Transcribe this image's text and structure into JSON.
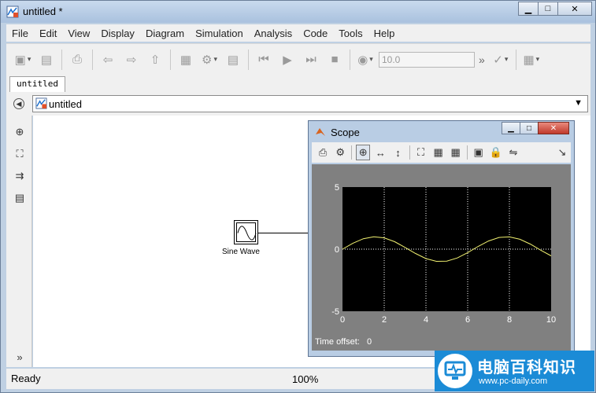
{
  "window": {
    "title": "untitled *"
  },
  "menu": [
    "File",
    "Edit",
    "View",
    "Display",
    "Diagram",
    "Simulation",
    "Analysis",
    "Code",
    "Tools",
    "Help"
  ],
  "toolbar": {
    "stop_time": "10.0"
  },
  "tab": {
    "label": "untitled"
  },
  "explorer": {
    "path": "untitled"
  },
  "canvas": {
    "block_label": "Sine Wave"
  },
  "status": {
    "left": "Ready",
    "zoom": "100%"
  },
  "scope": {
    "title": "Scope",
    "time_offset_label": "Time offset:",
    "time_offset_value": "0"
  },
  "chart_data": {
    "type": "line",
    "title": "",
    "xlabel": "",
    "ylabel": "",
    "xlim": [
      0,
      10
    ],
    "ylim": [
      -5,
      5
    ],
    "xticks": [
      "0",
      "2",
      "4",
      "6",
      "8",
      "10"
    ],
    "yticks": [
      "5",
      "0",
      "-5"
    ],
    "grid": true,
    "series": [
      {
        "x": [
          0,
          0.5,
          1,
          1.5,
          2,
          2.5,
          3,
          3.5,
          4,
          4.5,
          5,
          5.5,
          6,
          6.5,
          7,
          7.5,
          8,
          8.5,
          9,
          9.5,
          10
        ],
        "y": [
          0,
          0.48,
          0.84,
          1.0,
          0.91,
          0.6,
          0.14,
          -0.35,
          -0.76,
          -0.98,
          -0.96,
          -0.71,
          -0.28,
          0.22,
          0.66,
          0.94,
          0.99,
          0.8,
          0.41,
          -0.08,
          -0.54
        ]
      }
    ]
  },
  "watermark": {
    "text": "电脑百科知识",
    "url": "www.pc-daily.com"
  },
  "colors": {
    "plot_bg": "#000000",
    "signal": "#f0f070",
    "scope_bg": "#808080"
  }
}
